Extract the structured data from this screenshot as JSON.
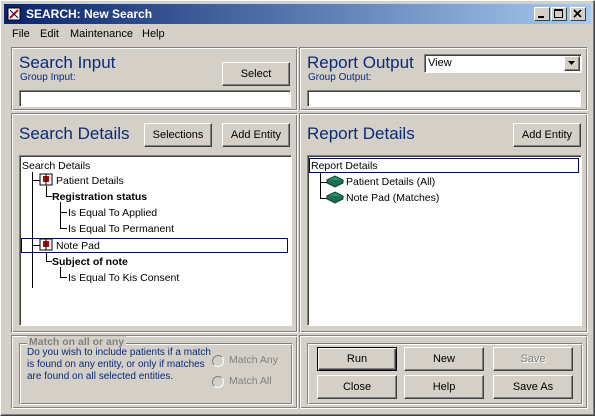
{
  "window": {
    "title": "SEARCH: New Search"
  },
  "menu": [
    "File",
    "Edit",
    "Maintenance",
    "Help"
  ],
  "search_input": {
    "title": "Search Input",
    "subtitle": "Group Input:",
    "select_label": "Select",
    "value": ""
  },
  "report_output": {
    "title": "Report Output",
    "subtitle": "Group Output:",
    "dropdown_value": "View",
    "value": ""
  },
  "search_details": {
    "title": "Search Details",
    "selections_label": "Selections",
    "add_entity_label": "Add Entity",
    "tree": {
      "root": "Search Details",
      "entity1": "Patient Details",
      "field1": "Registration status",
      "cond1a": "Is Equal To Applied",
      "cond1b": "Is Equal To Permanent",
      "entity2": "Note Pad",
      "field2": "Subject of note",
      "cond2": "Is Equal To Kis Consent"
    }
  },
  "report_details": {
    "title": "Report Details",
    "add_entity_label": "Add Entity",
    "tree": {
      "root": "Report Details",
      "item1": "Patient Details (All)",
      "item2": "Note Pad (Matches)"
    }
  },
  "match": {
    "title": "Match on all or any",
    "description": "Do you wish to include patients if a match is found on any entity, or only if matches are found on all selected entities.",
    "option_any": "Match Any",
    "option_all": "Match All"
  },
  "actions": {
    "run": "Run",
    "new": "New",
    "save": "Save",
    "close": "Close",
    "help": "Help",
    "save_as": "Save As"
  }
}
